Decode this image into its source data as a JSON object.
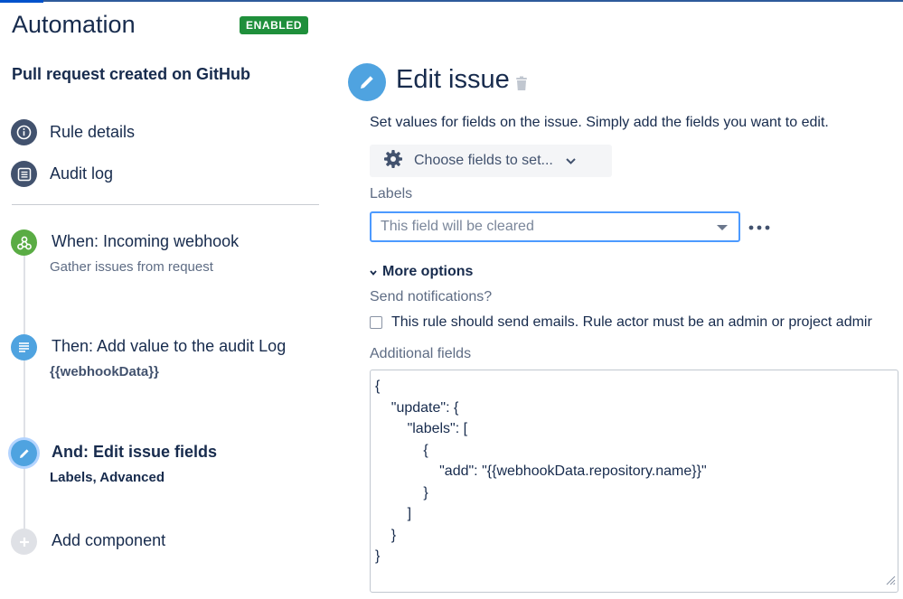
{
  "header": {
    "title": "Automation",
    "status_badge": "ENABLED"
  },
  "sidebar": {
    "rule_name": "Pull request created on GitHub",
    "nav": [
      {
        "label": "Rule details",
        "icon": "info-icon"
      },
      {
        "label": "Audit log",
        "icon": "list-icon"
      }
    ],
    "steps": [
      {
        "title": "When: Incoming webhook",
        "subtitle": "Gather issues from request",
        "icon": "webhook-icon",
        "color": "#5aac44"
      },
      {
        "title": "Then: Add value to the audit Log",
        "subtitle": "{{webhookData}}",
        "icon": "log-icon",
        "color": "#4fa3e0"
      },
      {
        "title": "And: Edit issue fields",
        "subtitle": "Labels, Advanced",
        "icon": "pencil-icon",
        "color": "#4fa3e0"
      },
      {
        "title": "Add component",
        "icon": "plus-icon",
        "color": "#dfe1e6"
      }
    ]
  },
  "panel": {
    "title": "Edit issue",
    "description": "Set values for fields on the issue. Simply add the fields you want to edit.",
    "choose_fields_label": "Choose fields to set...",
    "labels_field": {
      "label": "Labels",
      "placeholder": "This field will be cleared"
    },
    "more_options_label": "More options",
    "send_notifications_label": "Send notifications?",
    "send_emails_checkbox": {
      "label": "This rule should send emails. Rule actor must be an admin or project admir",
      "checked": false
    },
    "additional_fields": {
      "label": "Additional fields",
      "value": "{\n    \"update\": {\n        \"labels\": [\n            {\n                \"add\": \"{{webhookData.repository.name}}\"\n            }\n        ]\n    }\n}"
    }
  },
  "colors": {
    "primary_text": "#172b4d",
    "badge_green": "#1f8f3b",
    "focus_blue": "#4c9aff",
    "icon_blue": "#4fa3e0",
    "nav_icon": "#42526e"
  }
}
